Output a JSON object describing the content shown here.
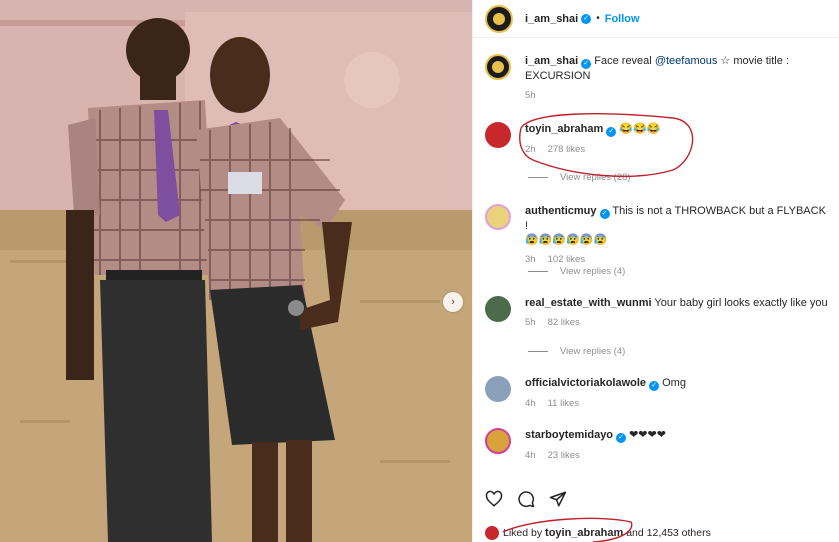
{
  "post": {
    "author": "i_am_shai",
    "follow_label": "Follow",
    "dot": "•",
    "caption_prefix": "Face reveal",
    "caption_mention": "@teefamous",
    "caption_star": "☆",
    "caption_suffix": "movie title :",
    "caption_line2": "EXCURSION",
    "caption_time": "5h",
    "next_icon": "chevron-right-icon",
    "next_glyph": "›"
  },
  "comments": [
    {
      "user": "toyin_abraham",
      "text": "😂😂😂",
      "time": "2h",
      "likes": "278 likes",
      "replies": "View replies (28)"
    },
    {
      "user": "authenticmuy",
      "text": "This is not a THROWBACK but a FLYBACK !",
      "text2": "😰😰😰😰😰😰",
      "time": "3h",
      "likes": "102 likes",
      "replies": "View replies (4)"
    },
    {
      "user": "real_estate_with_wunmi",
      "text": "Your baby girl looks exactly like you",
      "time": "5h",
      "likes": "82 likes",
      "replies": "View replies (4)"
    },
    {
      "user": "officialvictoriakolawole",
      "text": "Omg",
      "time": "4h",
      "likes": "11 likes"
    },
    {
      "user": "starboytemidayo",
      "text": "❤❤❤❤",
      "time": "4h",
      "likes": "23 likes"
    }
  ],
  "footer": {
    "liked_prefix": "Liked by",
    "liked_user": "toyin_abraham",
    "liked_suffix": "and 12,453 others",
    "icons": [
      "heart-icon",
      "comment-icon",
      "share-icon"
    ]
  },
  "colors": {
    "accent": "#0095f6",
    "annotation": "#c0202a"
  }
}
